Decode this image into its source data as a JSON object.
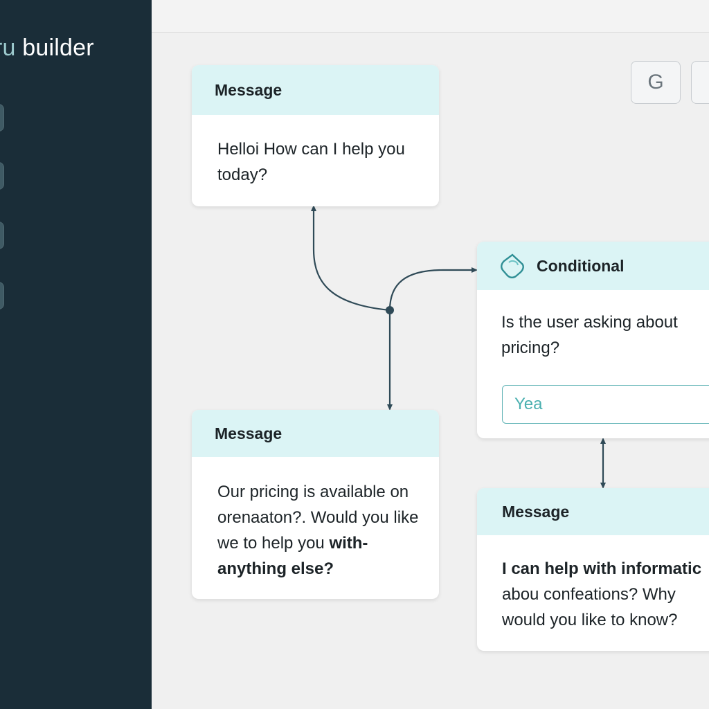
{
  "sidebar": {
    "brand_prefix": "ru",
    "brand_suffix": " builder"
  },
  "toolbar": {
    "g_button": "G"
  },
  "nodes": {
    "greeting": {
      "type_label": "Message",
      "text": "Helloi How can I help you today?"
    },
    "conditional": {
      "type_label": "Conditional",
      "question": "Is the user asking about pricing?",
      "answer_value": "Yea"
    },
    "pricing_reply": {
      "type_label": "Message",
      "text_plain": "Our pricing is available on orenaaton?. Would you like we to help you ",
      "text_bold": "with-anything else?"
    },
    "info_reply": {
      "type_label": "Message",
      "text_bold": "I can help with informatic",
      "text_plain": "abou confeations?  Why would you like to know?"
    }
  },
  "colors": {
    "sidebar": "#1a2d38",
    "canvas": "#f0f0f0",
    "card_header": "#dbf4f5",
    "accent": "#4bb0b0",
    "connector": "#2f4a57"
  }
}
